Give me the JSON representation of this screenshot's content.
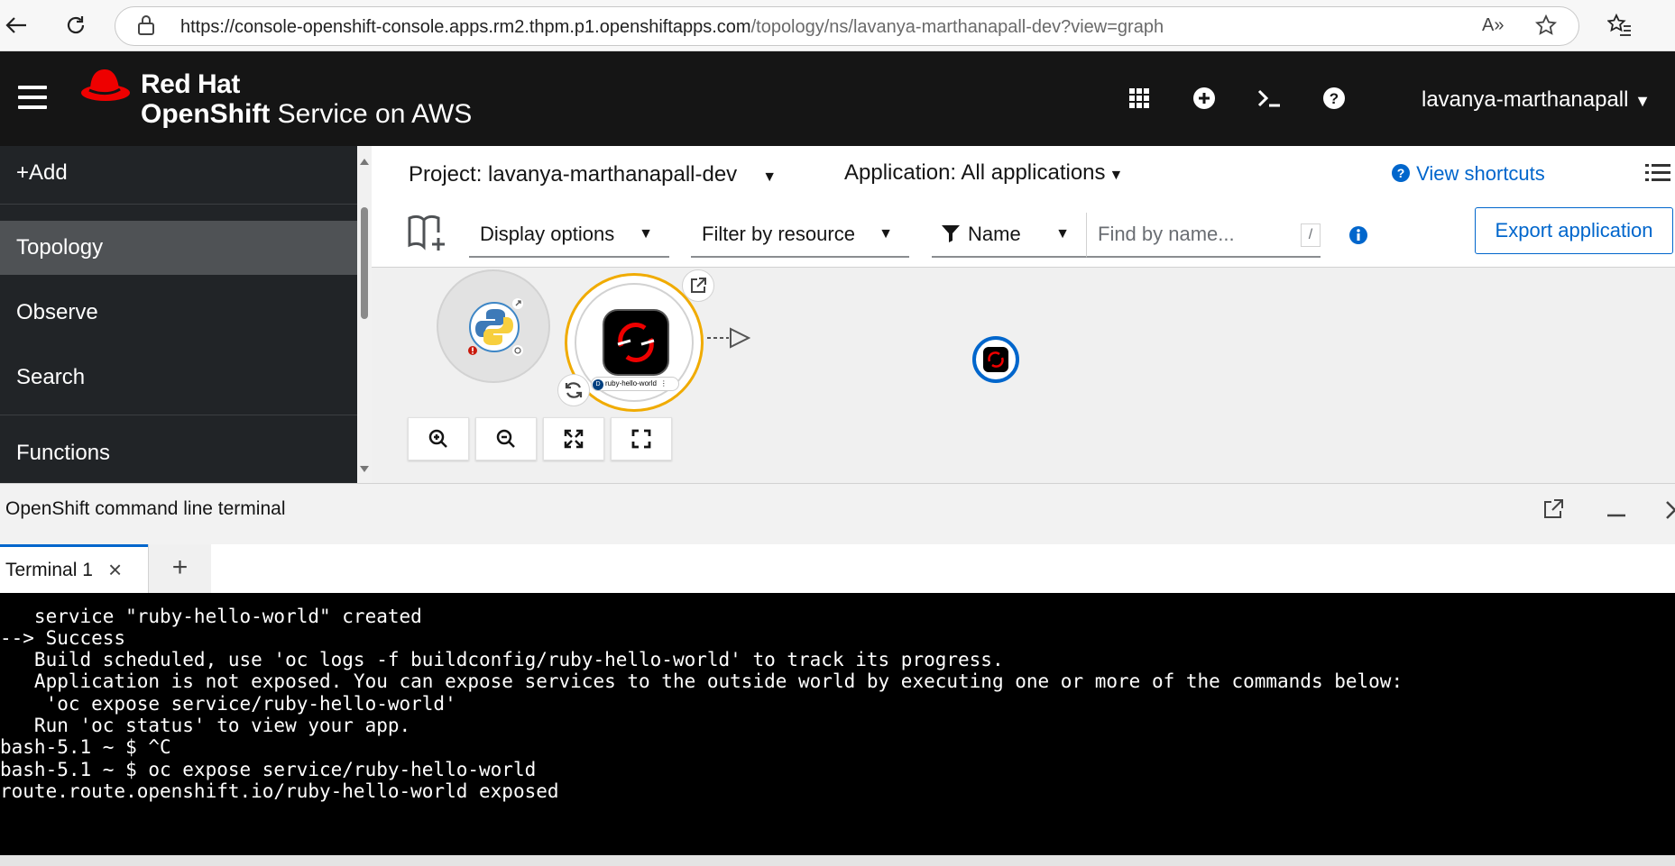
{
  "browser": {
    "url_host": "https://console-openshift-console.apps.rm2.thpm.p1.openshiftapps.com",
    "url_path": "/topology/ns/lavanya-marthanapall-dev?view=graph",
    "read_aloud": "A»"
  },
  "masthead": {
    "brand_top": "Red Hat",
    "brand_bold": "OpenShift",
    "brand_rest": " Service on AWS",
    "user": "lavanya-marthanapall"
  },
  "sidebar": {
    "items": [
      {
        "label": "+Add"
      },
      {
        "label": "Topology"
      },
      {
        "label": "Observe"
      },
      {
        "label": "Search"
      },
      {
        "label": "Functions"
      }
    ]
  },
  "main": {
    "project": "Project: lavanya-marthanapall-dev",
    "application": "Application: All applications",
    "shortcuts": "View shortcuts",
    "toolbar": {
      "display_options": "Display options",
      "filter_by_resource": "Filter by resource",
      "name_filter": "Name",
      "find_placeholder": "Find by name...",
      "slash": "/",
      "export": "Export application"
    },
    "node": {
      "badge": "D",
      "label": "ruby-hello-world"
    }
  },
  "terminal": {
    "panel_title": "OpenShift command line terminal",
    "tab_label": "Terminal 1",
    "lines": [
      "   service \"ruby-hello-world\" created",
      "--> Success",
      "   Build scheduled, use 'oc logs -f buildconfig/ruby-hello-world' to track its progress.",
      "   Application is not exposed. You can expose services to the outside world by executing one or more of the commands below:",
      "    'oc expose service/ruby-hello-world'",
      "   Run 'oc status' to view your app.",
      "bash-5.1 ~ $ ^C",
      "bash-5.1 ~ $ oc expose service/ruby-hello-world",
      "route.route.openshift.io/ruby-hello-world exposed"
    ]
  },
  "colors": {
    "masthead": "#151515",
    "sidebar": "#212427",
    "link": "#0066cc",
    "redhat": "#ee0000",
    "node_ring": "#f0ab00"
  }
}
